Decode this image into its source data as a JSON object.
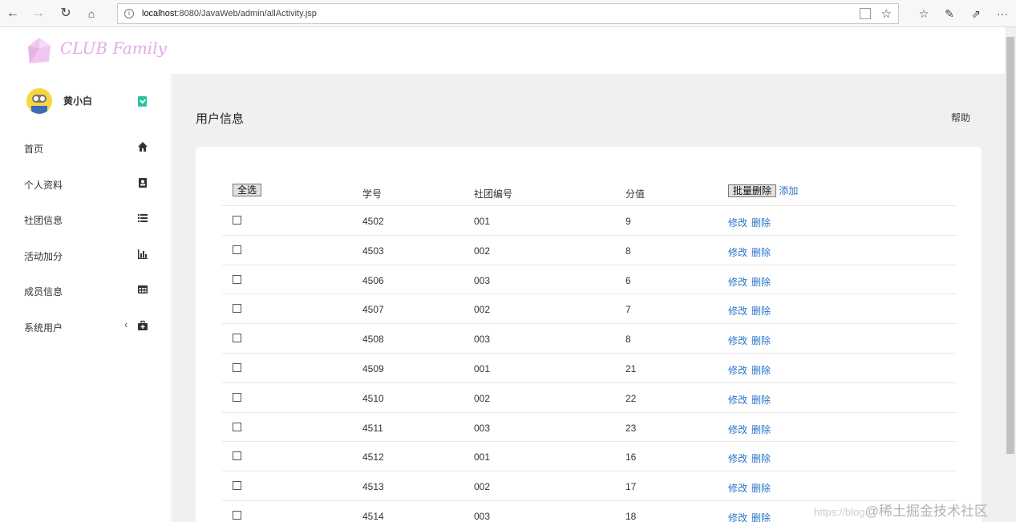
{
  "browser": {
    "url_host": "localhost",
    "url_rest": ":8080/JavaWeb/admin/allActivity.jsp",
    "info_icon": "i"
  },
  "app": {
    "logo_text": "CLUB Family"
  },
  "user": {
    "name": "黄小白"
  },
  "sidebar": {
    "items": [
      {
        "label": "首页",
        "icon": "home-icon"
      },
      {
        "label": "个人资料",
        "icon": "contact-card-icon"
      },
      {
        "label": "社团信息",
        "icon": "list-icon"
      },
      {
        "label": "活动加分",
        "icon": "bar-chart-icon"
      },
      {
        "label": "成员信息",
        "icon": "table-icon"
      },
      {
        "label": "系统用户",
        "icon": "briefcase-add-icon"
      }
    ]
  },
  "main": {
    "title": "用户信息",
    "help": "帮助"
  },
  "table": {
    "select_all": "全选",
    "headers": [
      "学号",
      "社团编号",
      "分值"
    ],
    "batch_delete": "批量删除",
    "add": "添加",
    "edit_label": "修改",
    "delete_label": "删除",
    "rows": [
      {
        "id": "4502",
        "club": "001",
        "score": "9"
      },
      {
        "id": "4503",
        "club": "002",
        "score": "8"
      },
      {
        "id": "4506",
        "club": "003",
        "score": "6"
      },
      {
        "id": "4507",
        "club": "002",
        "score": "7"
      },
      {
        "id": "4508",
        "club": "003",
        "score": "8"
      },
      {
        "id": "4509",
        "club": "001",
        "score": "21"
      },
      {
        "id": "4510",
        "club": "002",
        "score": "22"
      },
      {
        "id": "4511",
        "club": "003",
        "score": "23"
      },
      {
        "id": "4512",
        "club": "001",
        "score": "16"
      },
      {
        "id": "4513",
        "club": "002",
        "score": "17"
      },
      {
        "id": "4514",
        "club": "003",
        "score": "18"
      }
    ]
  },
  "watermark": {
    "prefix": "https://blog",
    "text": "@稀土掘金技术社区"
  }
}
